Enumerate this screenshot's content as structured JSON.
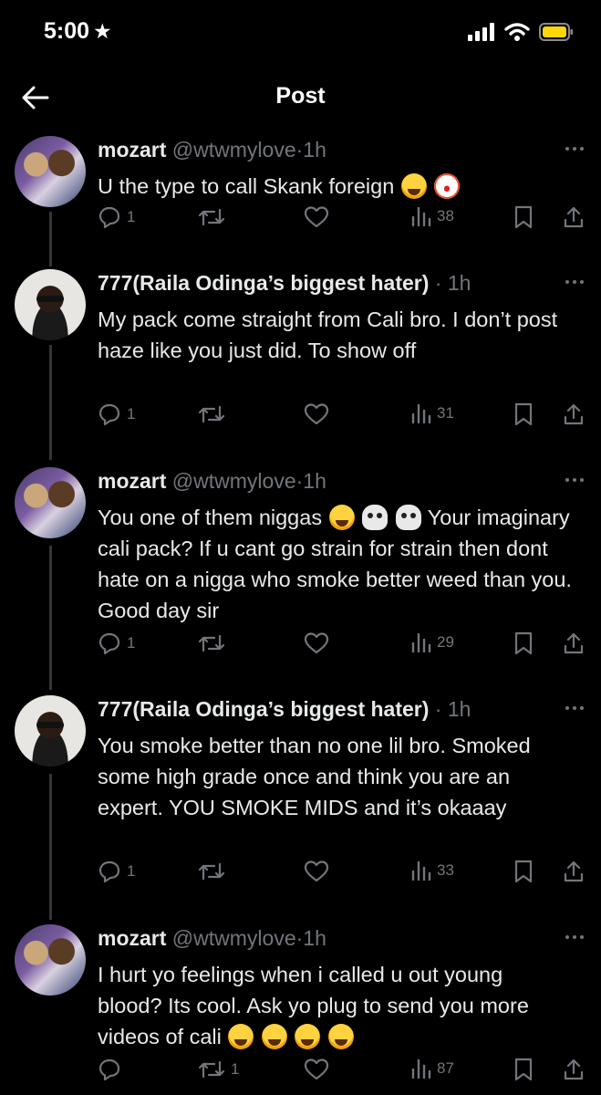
{
  "status": {
    "time": "5:00"
  },
  "nav": {
    "title": "Post"
  },
  "tweets": [
    {
      "name": "mozart",
      "handle": "@wtwmylove",
      "time": "1h",
      "segments": [
        "U the type to call Skank foreign ",
        ""
      ],
      "replies": "1",
      "reposts": "",
      "views": "38"
    },
    {
      "name": "777(Raila Odinga’s biggest hater)",
      "handle": "",
      "time": "1h",
      "text": "My pack come straight from Cali bro. I don’t post haze like you just did. To show off",
      "replies": "1",
      "reposts": "",
      "views": "31"
    },
    {
      "name": "mozart",
      "handle": "@wtwmylove",
      "time": "1h",
      "text_a": "You one of them niggas ",
      "text_b": " Your imaginary cali pack? If u cant go strain for strain then dont hate on a nigga who smoke better weed than you. Good day sir",
      "replies": "1",
      "reposts": "",
      "views": "29"
    },
    {
      "name": "777(Raila Odinga’s biggest hater)",
      "handle": "",
      "time": "1h",
      "text": "You smoke better than no one lil bro. Smoked some high grade once and think you are an expert. YOU SMOKE MIDS and it’s okaaay",
      "replies": "1",
      "reposts": "",
      "views": "33"
    },
    {
      "name": "mozart",
      "handle": "@wtwmylove",
      "time": "1h",
      "text": "I hurt yo feelings when i called u out young blood? Its cool. Ask yo plug to send you more videos of cali ",
      "replies": "",
      "reposts": "1",
      "views": "87"
    }
  ],
  "icons": [
    "back-arrow",
    "star",
    "signal",
    "wifi",
    "battery",
    "reply",
    "repost",
    "like",
    "views",
    "bookmark",
    "share",
    "more"
  ]
}
